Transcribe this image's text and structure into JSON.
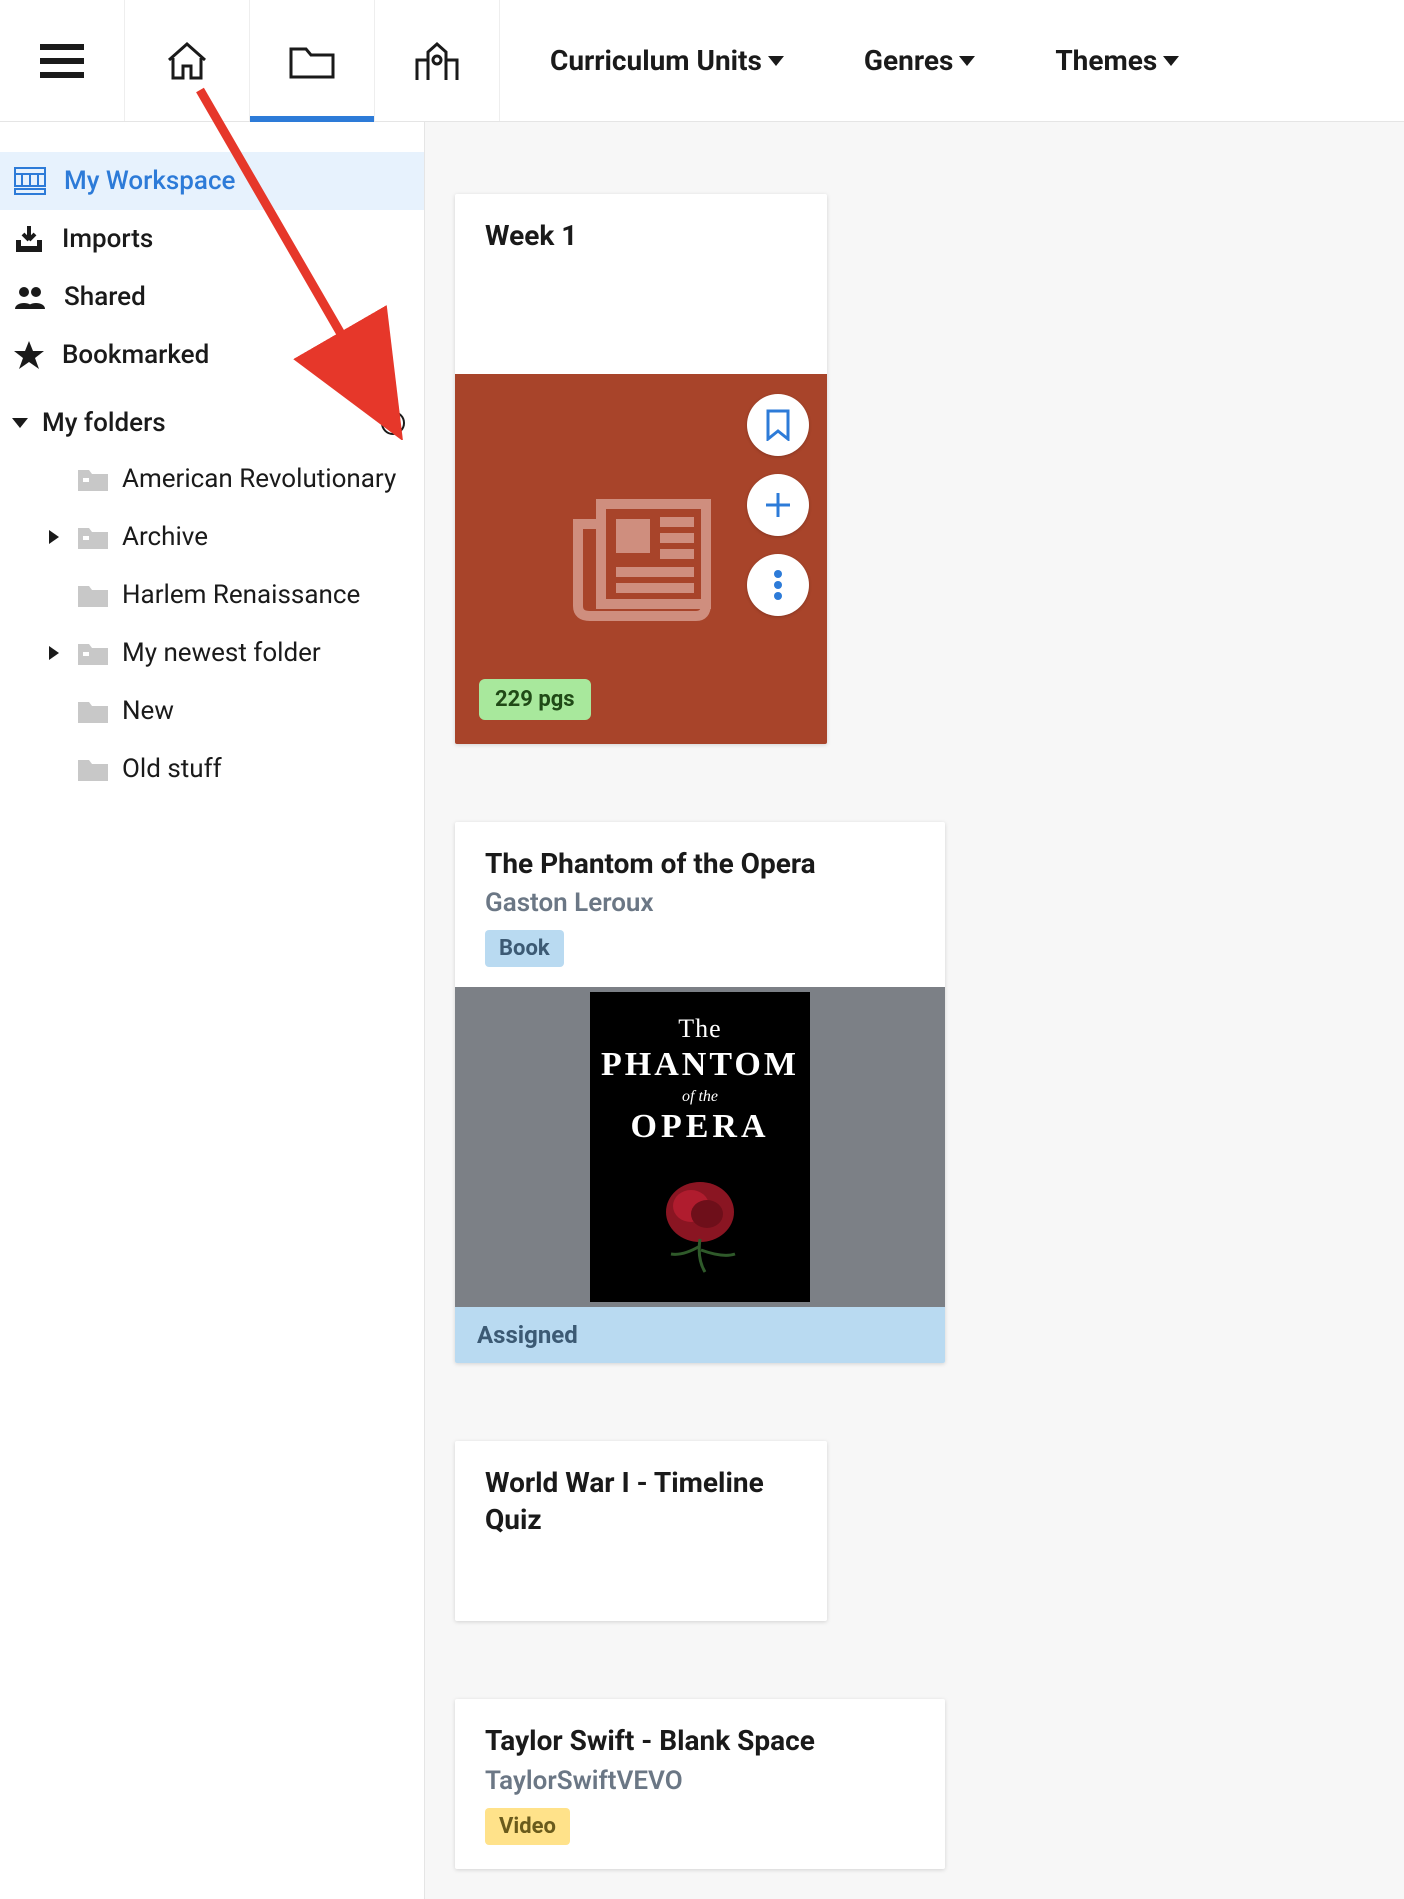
{
  "topnav": {
    "menu": [
      {
        "label": "Curriculum Units"
      },
      {
        "label": "Genres"
      },
      {
        "label": "Themes"
      }
    ]
  },
  "sidebar": {
    "workspace": "My Workspace",
    "imports": "Imports",
    "shared": "Shared",
    "bookmarked": "Bookmarked",
    "folders_label": "My folders",
    "folders": [
      {
        "label": "American Revolutionary",
        "expandable": false
      },
      {
        "label": "Archive",
        "expandable": true
      },
      {
        "label": "Harlem Renaissance",
        "expandable": false
      },
      {
        "label": "My newest folder",
        "expandable": true
      },
      {
        "label": "New",
        "expandable": false
      },
      {
        "label": "Old stuff",
        "expandable": false
      }
    ]
  },
  "cards": {
    "week1": {
      "title": "Week 1",
      "pages": "229 pgs"
    },
    "phantom": {
      "title": "The Phantom of the Opera",
      "author": "Gaston Leroux",
      "chip": "Book",
      "assigned": "Assigned",
      "cover_l1": "The",
      "cover_l2": "PHANTOM",
      "cover_l3": "of the",
      "cover_l4": "OPERA"
    },
    "ww1": {
      "title": "World War I - Timeline Quiz"
    },
    "swift": {
      "title": "Taylor Swift - Blank Space",
      "author": "TaylorSwiftVEVO",
      "chip": "Video"
    }
  }
}
